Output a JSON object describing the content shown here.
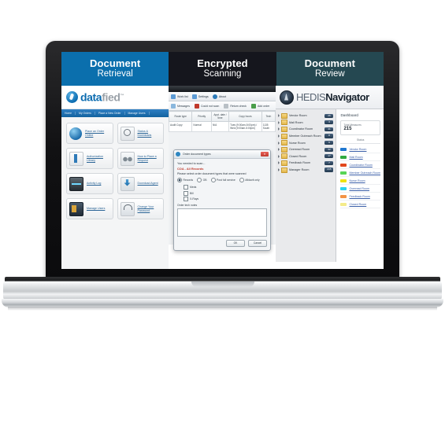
{
  "tabs": [
    {
      "title": "Document",
      "subtitle": "Retrieval",
      "color": "#0b6fad"
    },
    {
      "title": "Encrypted",
      "subtitle": "Scanning",
      "color": "#15161d"
    },
    {
      "title": "Document",
      "subtitle": "Review",
      "color": "#254851"
    }
  ],
  "datafied": {
    "logo_a": "data",
    "logo_b": "fied",
    "logo_tm": "™",
    "nav": [
      "Home",
      "My Orders",
      "Place a New Order",
      "Manage Users"
    ],
    "tiles": [
      {
        "label": "Place an Order Online",
        "icon": "globe-icon"
      },
      {
        "label": "Status & Downloads",
        "icon": "magnifier-icon"
      },
      {
        "label": "Authorization Library",
        "icon": "book-icon"
      },
      {
        "label": "How to Place a Request",
        "icon": "binoculars-icon"
      },
      {
        "label": "Activity Log",
        "icon": "activity-monitor-icon"
      },
      {
        "label": "Download Agent",
        "icon": "download-icon"
      },
      {
        "label": "Manage Users",
        "icon": "users-icon"
      },
      {
        "label": "Change Your Password",
        "icon": "lock-icon"
      }
    ]
  },
  "scanning": {
    "menu": [
      {
        "label": "Work list",
        "icon": "list-icon"
      },
      {
        "label": "Settings",
        "icon": "settings-icon"
      },
      {
        "label": "About",
        "icon": "info-icon"
      }
    ],
    "toolbar": [
      {
        "label": "Messages",
        "icon": "message-icon"
      },
      {
        "label": "Could not scan",
        "icon": "error-icon"
      },
      {
        "label": "Return check",
        "icon": "return-icon"
      },
      {
        "label": "Add order",
        "icon": "add-icon"
      }
    ],
    "table": {
      "headers": [
        "Route type",
        "Priority",
        "Appt. date / time",
        "Copy hours",
        "Tech"
      ],
      "rows": [
        [
          "Audit Copy",
          "Normal",
          "N/A",
          "Tues (9:00am-5:00pm) / Wed (9:00am-5:00pm)",
          "1135 South"
        ]
      ]
    },
    "dialog": {
      "title": "Order document types",
      "close_label": "✕",
      "line1": "You needed to scan...",
      "line2": "COA - All Records",
      "line3": "Please select order document types that were scanned",
      "radios": [
        {
          "label": "Records",
          "selected": true
        },
        {
          "label": "OB",
          "selected": false
        },
        {
          "label": "Post full service",
          "selected": false
        },
        {
          "label": "Afidavit only",
          "selected": false
        }
      ],
      "checks": [
        {
          "label": "Meds",
          "checked": false
        },
        {
          "label": "Bill",
          "checked": false
        },
        {
          "label": "X-Rays",
          "checked": false
        }
      ],
      "notes_label": "Order tech notes",
      "notes_value": "",
      "ok_label": "OK",
      "cancel_label": "Cancel"
    }
  },
  "hedis": {
    "logo_a": "HEDIS",
    "logo_b": "Navigator",
    "rooms": [
      {
        "label": "Vendor Room",
        "count": "26"
      },
      {
        "label": "Mail Room",
        "count": "3"
      },
      {
        "label": "Coordinator Room",
        "count": "41"
      },
      {
        "label": "Member Outreach Room",
        "count": "8"
      },
      {
        "label": "Nurse Room",
        "count": "6"
      },
      {
        "label": "Overread Room",
        "count": "32"
      },
      {
        "label": "Closed Room",
        "count": "17"
      },
      {
        "label": "Feedback Room",
        "count": "7"
      },
      {
        "label": "Manager Room",
        "count": "215"
      }
    ],
    "dashboard_title": "Dashboard",
    "metric_label": "Total Measures",
    "metric_value": "215",
    "legend_header": "Status",
    "legend": [
      {
        "label": "Vendor Room",
        "color": "#1f77d0"
      },
      {
        "label": "Mail Room",
        "color": "#2faa3f"
      },
      {
        "label": "Coordinator Room",
        "color": "#e2471c"
      },
      {
        "label": "Member Outreach Room",
        "color": "#58d455"
      },
      {
        "label": "Nurse Room",
        "color": "#efe212"
      },
      {
        "label": "Overread Room",
        "color": "#2ad2ef"
      },
      {
        "label": "Feedback Room",
        "color": "#f29345"
      },
      {
        "label": "Closed Room",
        "color": "#f4eb8a"
      }
    ]
  }
}
